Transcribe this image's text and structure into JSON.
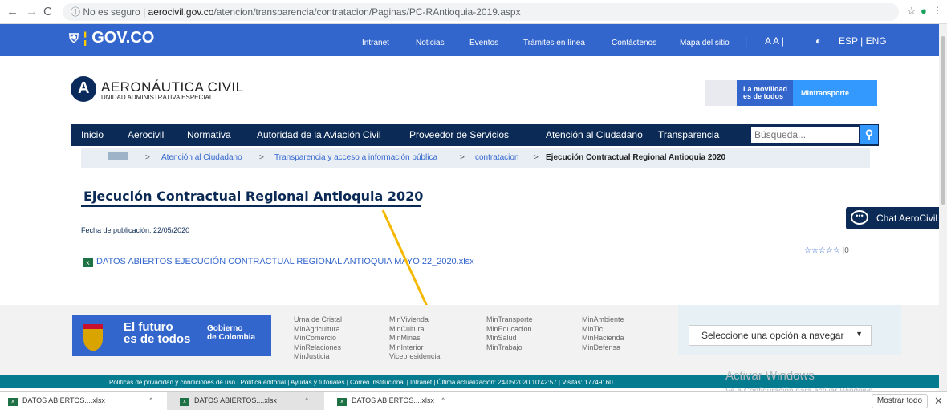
{
  "browser": {
    "insecure_label": "No es seguro",
    "url_domain": "aerocivil.gov.co",
    "url_path": "/atencion/transparencia/contratacion/Paginas/PC-RAntioquia-2019.aspx",
    "profile_initial": "M"
  },
  "govbar": {
    "logo": "GOV.CO",
    "links": [
      "Intranet",
      "Noticias",
      "Eventos",
      "Trámites en línea",
      "Contáctenos",
      "Mapa del sitio"
    ],
    "font_size": "A A |",
    "lang": "ESP | ENG"
  },
  "header": {
    "logo_letter": "A",
    "title": "AERONÁUTICA CIVIL",
    "subtitle": "UNIDAD ADMINISTRATIVA ESPECIAL",
    "movilidad_1": "La movilidad",
    "movilidad_2": "es de todos",
    "mintransporte": "Mintransporte"
  },
  "nav": {
    "items": [
      "Inicio",
      "Aerocivil",
      "Normativa",
      "Autoridad de la Aviación Civil",
      "Proveedor de Servicios",
      "Atención al Ciudadano",
      "Transparencia"
    ],
    "search_placeholder": "Búsqueda..."
  },
  "breadcrumb": {
    "items": [
      "Atención al Ciudadano",
      "Transparencia y acceso a información pública",
      "contratacion"
    ],
    "current": "Ejecución Contractual Regional Antioquia 2020",
    "sep": ">"
  },
  "main": {
    "title": "Ejecución Contractual Regional Antioquia 2020",
    "pub_date": "Fecha de publicación: 22/05/2020",
    "file": "DATOS ABIERTOS EJECUCIÓN CONTRACTUAL REGIONAL ANTIOQUIA MAYO 22_2020.xlsx",
    "rating_stars": "☆☆☆☆☆",
    "rating_count": "0",
    "chat": "Chat AeroCivil"
  },
  "footer": {
    "brand_1": "El futuro",
    "brand_2": "es de todos",
    "gov_1": "Gobierno",
    "gov_2": "de Colombia",
    "col1": [
      "Urna de Cristal",
      "MinAgricultura",
      "MinComercio",
      "MinRelaciones",
      "MinJusticia"
    ],
    "col2": [
      "MinVivienda",
      "MinCultura",
      "MinMinas",
      "MinInterior",
      "Vicepresidencia"
    ],
    "col3": [
      "MinTransporte",
      "MinEducación",
      "MinSalud",
      "MinTrabajo"
    ],
    "col4": [
      "MinAmbiente",
      "MinTic",
      "MinHacienda",
      "MinDefensa"
    ],
    "select": "Seleccione una opción a navegar",
    "bottom": "Políticas de privacidad y condiciones de uso  |  Política editorial  |  Ayudas y tutoriales  |  Correo institucional  |  Intranet  |  Última actualización: 24/05/2020 10:42:57  |  Visitas: 17749160"
  },
  "watermark": {
    "line1": "Activar Windows",
    "line2": "Ve a Configuración para activar Windows."
  },
  "downloads": {
    "files": [
      "DATOS ABIERTOS....xlsx",
      "DATOS ABIERTOS....xlsx",
      "DATOS ABIERTOS....xlsx"
    ],
    "show_all": "Mostrar todo"
  },
  "annotation": {
    "arrow_color": "#f5b800"
  }
}
